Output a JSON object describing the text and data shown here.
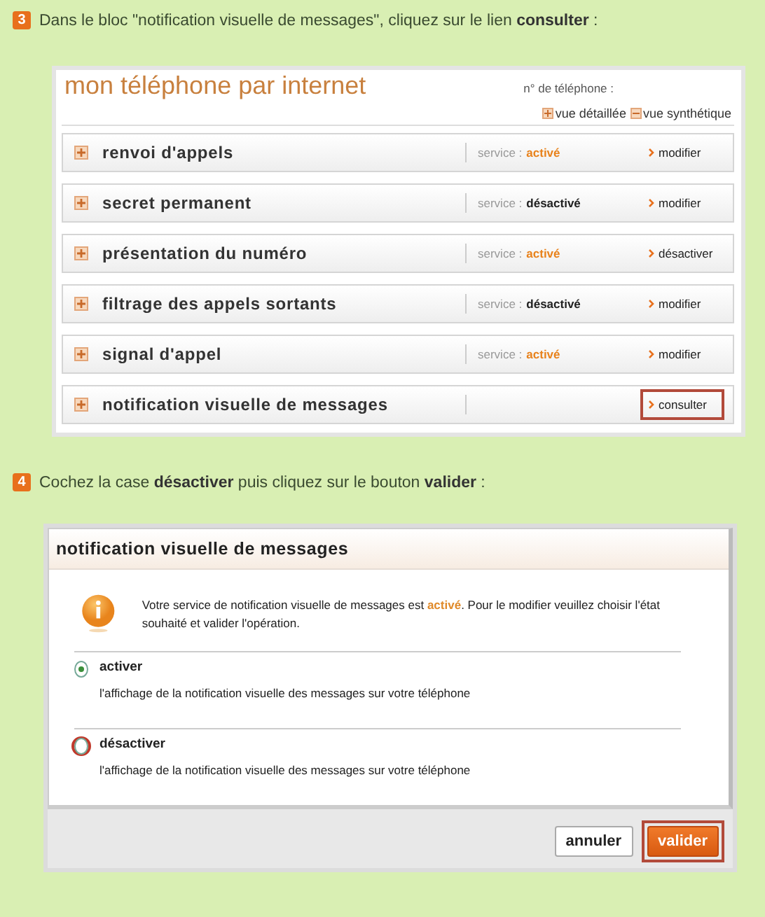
{
  "steps": [
    {
      "number": "3",
      "text": "Dans le bloc \"notification visuelle de messages\", cliquez sur le lien **consulter** :"
    },
    {
      "number": "4",
      "text": "Cochez la case **désactiver** puis cliquez sur le bouton **valider** :"
    }
  ],
  "services_panel": {
    "title": "mon téléphone par internet",
    "phone_label": "n° de téléphone :",
    "views": [
      {
        "label": "vue détaillée",
        "kind": "plus"
      },
      {
        "label": "vue synthétique",
        "kind": "minus"
      }
    ],
    "rows": [
      {
        "name": "renvoi d'appels",
        "service_label": "service :",
        "status": "activé",
        "active": true,
        "action": "modifier",
        "highlighted": false
      },
      {
        "name": "secret permanent",
        "service_label": "service :",
        "status": "désactivé",
        "active": false,
        "action": "modifier",
        "highlighted": false
      },
      {
        "name": "présentation du numéro",
        "service_label": "service :",
        "status": "activé",
        "active": true,
        "action": "désactiver",
        "highlighted": false
      },
      {
        "name": "filtrage des appels sortants",
        "service_label": "service :",
        "status": "désactivé",
        "active": false,
        "action": "modifier",
        "highlighted": false
      },
      {
        "name": "signal d'appel",
        "service_label": "service :",
        "status": "activé",
        "active": true,
        "action": "modifier",
        "highlighted": false
      },
      {
        "name": "notification visuelle de messages",
        "action": "consulter",
        "highlighted": true
      }
    ]
  },
  "dialog": {
    "title": "notification visuelle de messages",
    "info": "Votre service de notification visuelle de messages est **activé**. Pour le modifier veuillez choisir l'état souhaité et valider l'opération.",
    "options": [
      {
        "label": "activer",
        "description": "l'affichage de la notification visuelle des messages sur votre téléphone",
        "selected": true,
        "highlighted": false
      },
      {
        "label": "désactiver",
        "description": "l'affichage de la notification visuelle des messages sur votre téléphone",
        "selected": false,
        "highlighted": true
      }
    ],
    "buttons": [
      {
        "label": "annuler",
        "kind": "secondary",
        "highlighted": false
      },
      {
        "label": "valider",
        "kind": "primary",
        "highlighted": true
      }
    ]
  }
}
